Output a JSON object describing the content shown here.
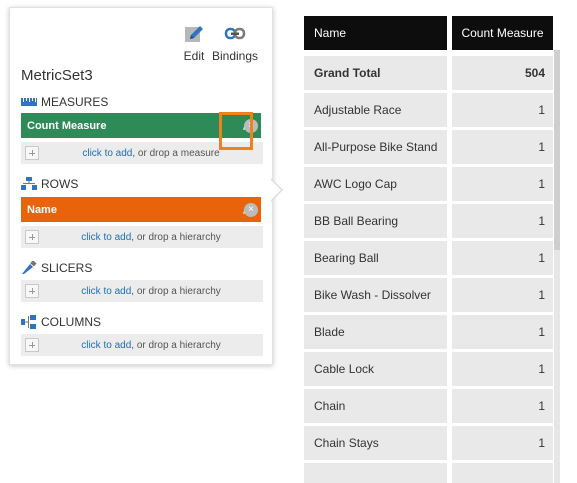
{
  "panel": {
    "toolbar": {
      "edit_label": "Edit",
      "bindings_label": "Bindings"
    },
    "title": "MetricSet3",
    "sections": {
      "measures": {
        "label": "MEASURES",
        "chip": "Count Measure",
        "drop_link": "click to add",
        "drop_rest": ", or drop a measure"
      },
      "rows": {
        "label": "ROWS",
        "chip": "Name",
        "drop_link": "click to add",
        "drop_rest": ", or drop a hierarchy"
      },
      "slicers": {
        "label": "SLICERS",
        "drop_link": "click to add",
        "drop_rest": ", or drop a hierarchy"
      },
      "columns": {
        "label": "COLUMNS",
        "drop_link": "click to add",
        "drop_rest": ", or drop a hierarchy"
      }
    },
    "chip_colors": {
      "measure": "#2e8b57",
      "row": "#e8630a",
      "highlight": "#f0821e"
    }
  },
  "table": {
    "headers": {
      "name": "Name",
      "count": "Count Measure"
    },
    "total": {
      "name": "Grand Total",
      "count": "504"
    },
    "rows": [
      {
        "name": "Adjustable Race",
        "count": "1"
      },
      {
        "name": "All-Purpose Bike Stand",
        "count": "1"
      },
      {
        "name": "AWC Logo Cap",
        "count": "1"
      },
      {
        "name": "BB Ball Bearing",
        "count": "1"
      },
      {
        "name": "Bearing Ball",
        "count": "1"
      },
      {
        "name": "Bike Wash - Dissolver",
        "count": "1"
      },
      {
        "name": "Blade",
        "count": "1"
      },
      {
        "name": "Cable Lock",
        "count": "1"
      },
      {
        "name": "Chain",
        "count": "1"
      },
      {
        "name": "Chain Stays",
        "count": "1"
      }
    ]
  }
}
